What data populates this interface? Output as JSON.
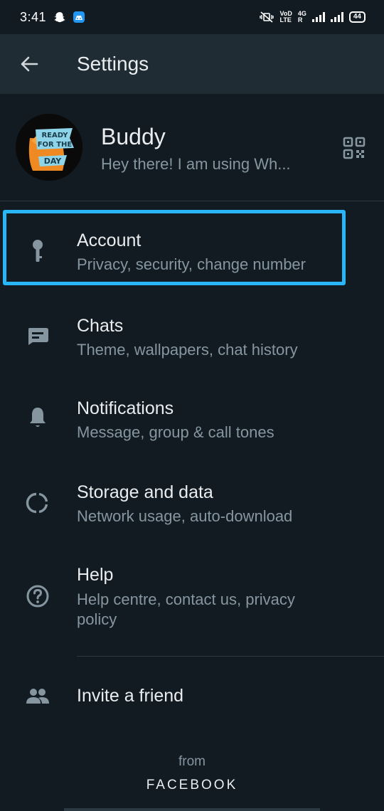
{
  "status_bar": {
    "time": "3:41",
    "network_top": "VoD",
    "network_bottom": "LTE",
    "generation": "4G",
    "roaming": "R",
    "battery": "44"
  },
  "header": {
    "title": "Settings"
  },
  "profile": {
    "name": "Buddy",
    "status": "Hey there! I am using Wh...",
    "avatar_text_line1": "READY",
    "avatar_text_line2": "FOR THE",
    "avatar_text_line3": "DAY"
  },
  "settings": {
    "account": {
      "title": "Account",
      "subtitle": "Privacy, security, change number"
    },
    "chats": {
      "title": "Chats",
      "subtitle": "Theme, wallpapers, chat history"
    },
    "notifications": {
      "title": "Notifications",
      "subtitle": "Message, group & call tones"
    },
    "storage": {
      "title": "Storage and data",
      "subtitle": "Network usage, auto-download"
    },
    "help": {
      "title": "Help",
      "subtitle": "Help centre, contact us, privacy policy"
    },
    "invite": {
      "title": "Invite a friend"
    }
  },
  "footer": {
    "from": "from",
    "brand": "FACEBOOK"
  },
  "colors": {
    "background": "#121b22",
    "app_bar": "#1f2c34",
    "primary_text": "#e9edef",
    "secondary_text": "#8696a0",
    "highlight": "#29b6f6"
  }
}
